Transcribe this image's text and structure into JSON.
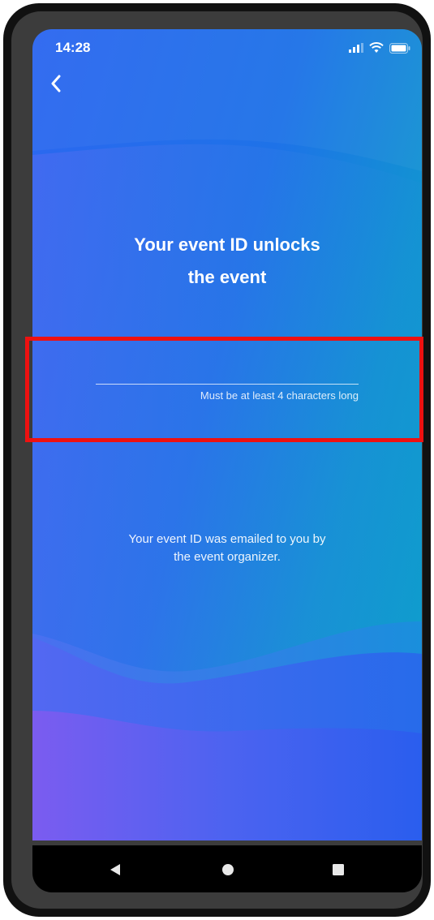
{
  "status_bar": {
    "time": "14:28",
    "icons": [
      "signal-icon",
      "wifi-icon",
      "battery-icon"
    ]
  },
  "navigation": {
    "back_icon": "chevron-left-icon"
  },
  "title": {
    "line1": "Your event ID unlocks",
    "line2": "the event"
  },
  "event_id_input": {
    "value": "",
    "hint": "Must be at least 4 characters long"
  },
  "info": {
    "line1": "Your event ID was emailed to you by",
    "line2": "the event organizer."
  },
  "system_nav": {
    "icons": [
      "back-triangle-icon",
      "home-circle-icon",
      "recents-square-icon"
    ]
  },
  "colors": {
    "gradient_start": "#2c67f0",
    "gradient_end": "#0aa3c8",
    "wave_purple": "#7b5cf0",
    "highlight": "#ee1111"
  }
}
